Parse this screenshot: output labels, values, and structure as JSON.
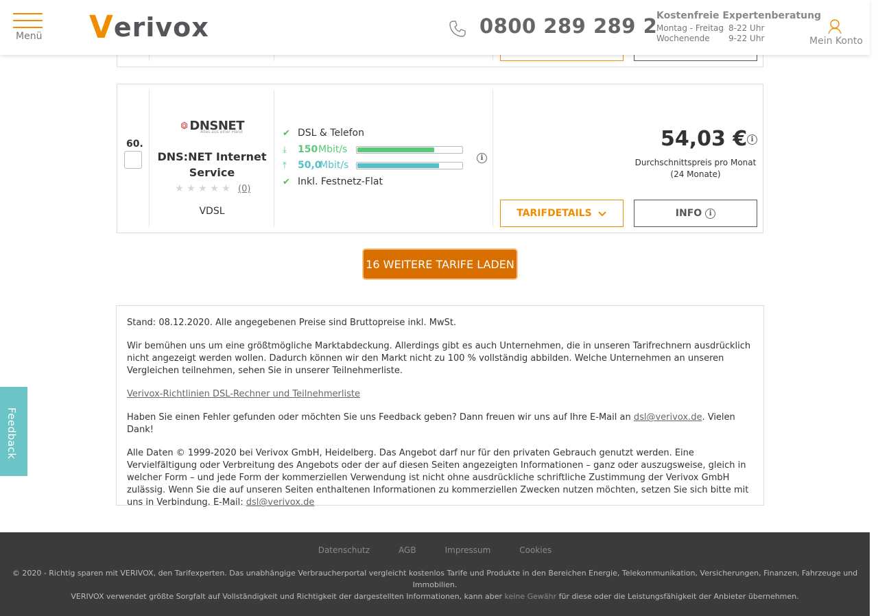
{
  "header": {
    "menu_label": "Menü",
    "logo_initial": "V",
    "logo_rest": "erivox",
    "phone": "0800 289 289 2",
    "expert_title": "Kostenfreie Expertenberatung",
    "hours": [
      {
        "days": "Montag - Freitag",
        "time": "8-22 Uhr"
      },
      {
        "days": "Wochenende",
        "time": "9-22 Uhr"
      }
    ],
    "account_label": "Mein Konto"
  },
  "tariff": {
    "rank": "60.",
    "provider_logo_text": "DNSNET",
    "provider_logo_sub": "Alles aus einer Hand",
    "provider_name": "DNS:NET Internet Service",
    "review_count": "(0)",
    "rating_stars": 0,
    "technology": "VDSL",
    "feature_1": "DSL & Telefon",
    "download_value": "150",
    "download_unit": "Mbit/s",
    "download_fill": 0.73,
    "upload_value": "50,0",
    "upload_unit": "Mbit/s",
    "upload_fill": 0.77,
    "feature_2": "Inkl. Festnetz-Flat",
    "price": "54,03 €",
    "price_label_1": "Durchschnittspreis pro Monat",
    "price_label_2": "(24 Monate)",
    "details_button": "TARIFDETAILS",
    "info_button": "INFO"
  },
  "load_more_label": "16 WEITERE TARIFE LADEN",
  "disclaimer": {
    "p1": "Stand: 08.12.2020. Alle angegebenen Preise sind Bruttopreise inkl. MwSt.",
    "p2": "Wir bemühen uns um eine größtmögliche Marktabdeckung. Allerdings gibt es auch Unternehmen, die in unseren Tarifrechnern ausdrücklich nicht angezeigt werden wollen. Dadurch können wir den Markt nicht zu 100 % vollständig abbilden. Welche Unternehmen an unseren Vergleichen teilnehmen, sehen Sie in unserer Teilnehmerliste.",
    "p3_link": "Verivox-Richtlinien DSL-Rechner und Teilnehmerliste",
    "p4_before": "Haben Sie einen Fehler gefunden oder möchten Sie uns Feedback geben? Dann freuen wir uns auf Ihre E-Mail an ",
    "p4_link": "dsl@verivox.de",
    "p4_after": ". Vielen Dank!",
    "p5_text": "Alle Daten © 1999-2020 bei Verivox GmbH, Heidelberg. Das Angebot darf nur für den privaten Gebrauch genutzt werden. Eine Vervielfältigung oder Verbreitung des Angebots oder der auf diesen Seiten angezeigten Informationen – ganz oder auszugsweise, gleich in welcher Form – und jede Form der kommerziellen Verwendung ist nicht ohne ausdrückliche schriftliche Zustimmung der Verivox GmbH zulässig. Wenn Sie die auf unseren Seiten enthaltenen Informationen zu kommerziellen Zwecken nutzen möchten, setzen Sie sich bitte mit uns in Verbindung. E-Mail: ",
    "p5_link": "dsl@verivox.de"
  },
  "feedback_label": "Feedback",
  "footer": {
    "links": [
      "Datenschutz",
      "AGB",
      "Impressum",
      "Cookies"
    ],
    "line1": "© 2020 - Richtig sparen mit VERIVOX, den Tarifexperten. Das unabhängige Verbraucherportal vergleicht kostenlos Tarife und Produkte in den Bereichen Energie, Telekommunikation, Versicherungen, Finanzen, Fahrzeuge und Immobilien.",
    "line2_before": "VERIVOX verwendet größte Sorgfalt auf Vollständigkeit und Richtigkeit der dargestellten Informationen, kann aber ",
    "line2_link": "keine Gewähr",
    "line2_after": " für diese oder die Leistungsfähigkeit der Anbieter übernehmen."
  },
  "colors": {
    "brand_orange": "#f08c00",
    "download_bar": "#5cc97a",
    "upload_bar": "#55c0c8",
    "feedback_tab": "#6bc5c6",
    "footer_bg": "#3b3b3b"
  },
  "icons": {
    "menu": "hamburger-icon",
    "phone": "phone-icon",
    "account": "user-icon",
    "check": "check-icon",
    "download": "download-arrow-icon",
    "upload": "upload-arrow-icon",
    "info": "info-icon",
    "chevron": "chevron-down-icon",
    "star": "star-icon"
  }
}
